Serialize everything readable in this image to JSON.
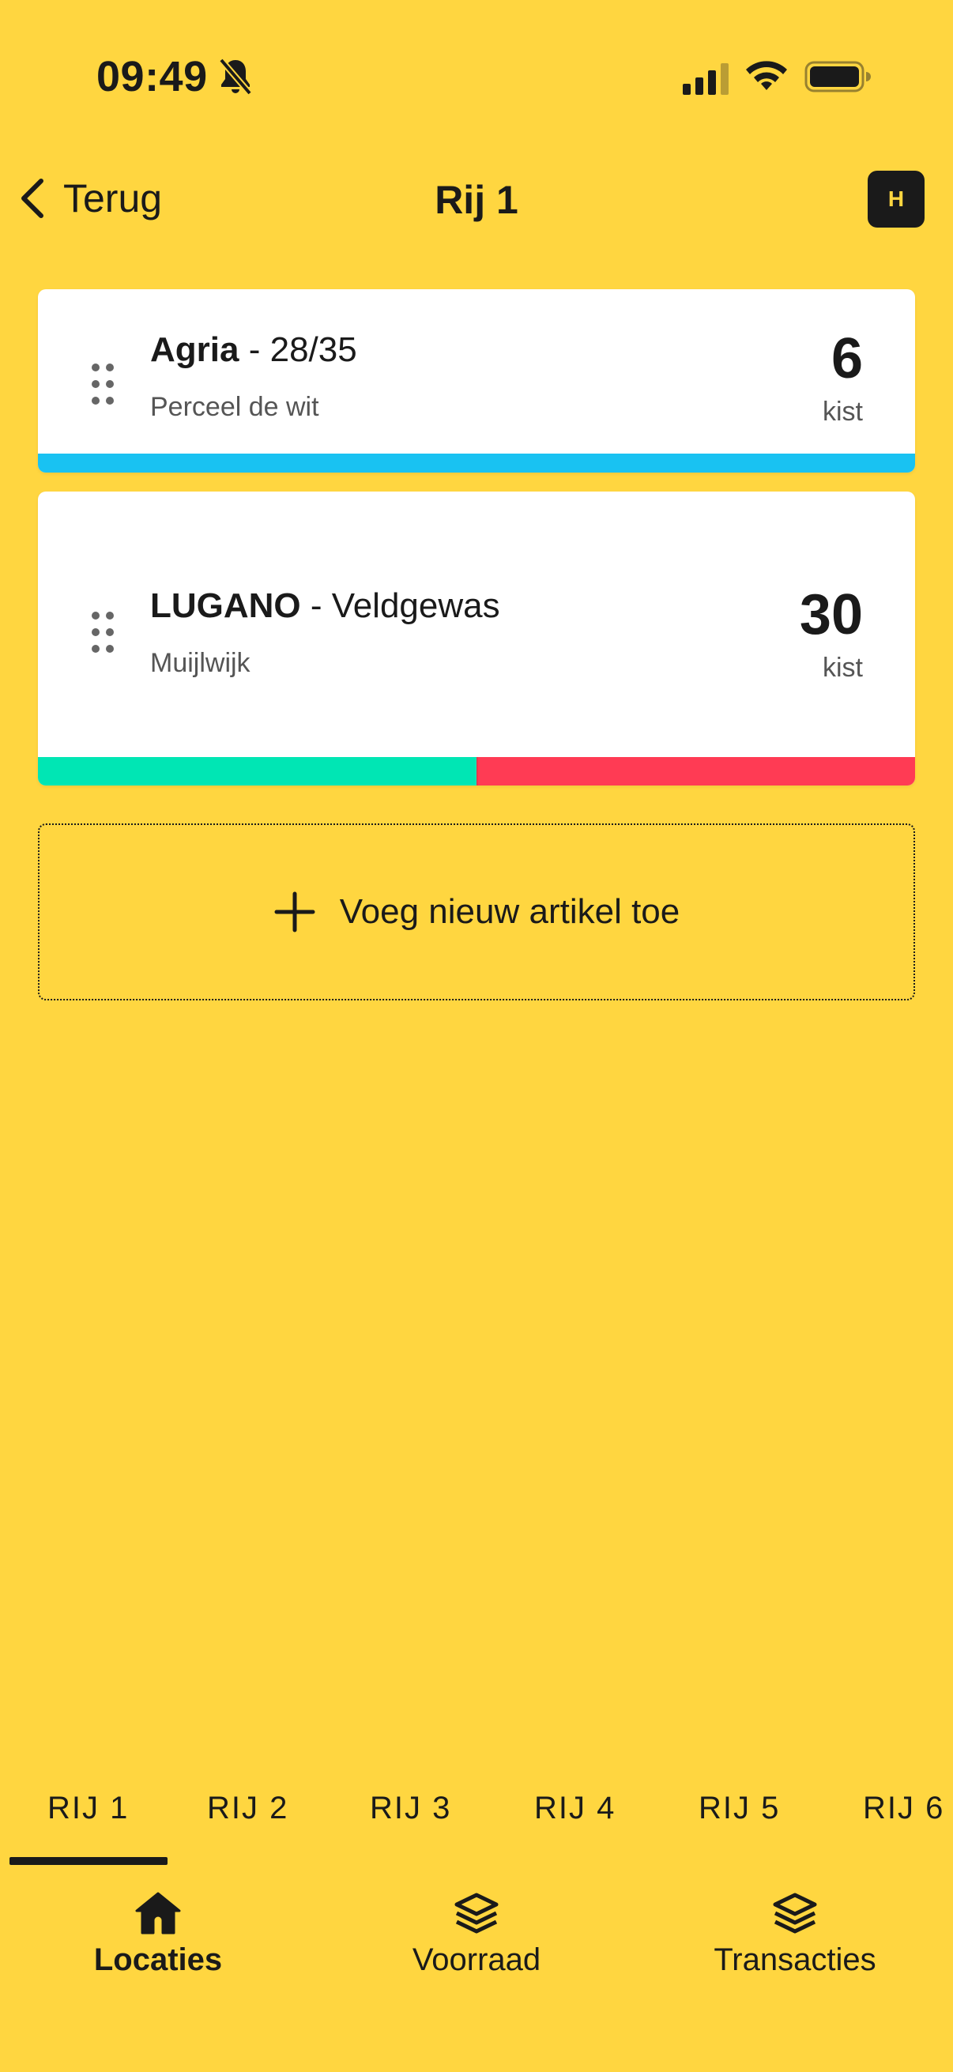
{
  "status_bar": {
    "time": "09:49",
    "icons": [
      "bell-slash-icon",
      "cellular-signal-icon",
      "wifi-icon",
      "battery-icon"
    ]
  },
  "header": {
    "back_label": "Terug",
    "title": "Rij 1",
    "avatar_initial": "H"
  },
  "items": [
    {
      "name": "Agria",
      "detail": "28/35",
      "location": "Perceel de wit",
      "quantity": "6",
      "unit": "kist",
      "bar": [
        {
          "color": "#19C2F2",
          "fraction": 1.0
        }
      ]
    },
    {
      "name": "LUGANO",
      "detail": "Veldgewas",
      "location": "Muijlwijk",
      "quantity": "30",
      "unit": "kist",
      "bar": [
        {
          "color": "#00E6B4",
          "fraction": 0.5
        },
        {
          "color": "#FF3B54",
          "fraction": 0.5
        }
      ]
    }
  ],
  "add_button": {
    "label": "Voeg nieuw artikel toe"
  },
  "row_tabs": {
    "tabs": [
      "RIJ 1",
      "RIJ 2",
      "RIJ 3",
      "RIJ 4",
      "RIJ 5",
      "RIJ 6"
    ],
    "active": "RIJ 1"
  },
  "bottom_nav": {
    "items": [
      {
        "label": "Locaties",
        "icon": "home-icon",
        "active": true
      },
      {
        "label": "Voorraad",
        "icon": "layers-icon",
        "active": false
      },
      {
        "label": "Transacties",
        "icon": "layers-icon",
        "active": false
      }
    ]
  },
  "colors": {
    "background": "#FFD640",
    "text": "#1A1A1A"
  }
}
